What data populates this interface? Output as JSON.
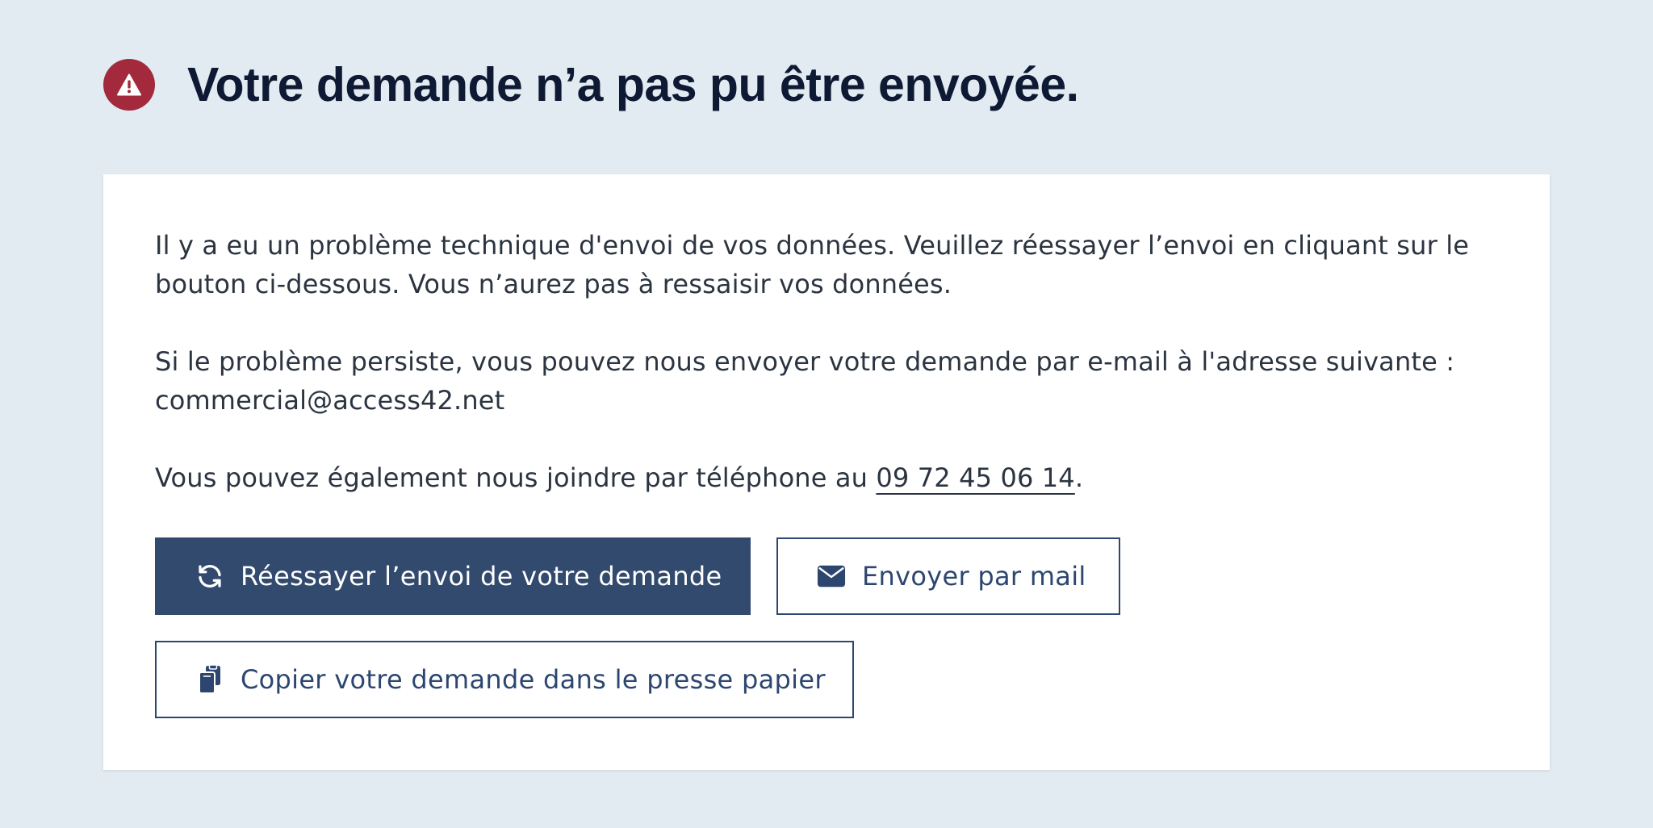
{
  "header": {
    "title": "Votre demande n’a pas pu être envoyée.",
    "icon": "warning-icon",
    "icon_color": "#a22a3c"
  },
  "message": {
    "paragraph1": "Il y a eu un problème technique d'envoi de vos données. Veuillez réessayer l’envoi en cliquant sur le bouton ci-dessous. Vous n’aurez pas à ressaisir vos données.",
    "paragraph2": "Si le problème persiste, vous pouvez nous envoyer votre demande par e-mail à l'adresse suivante : commercial@access42.net",
    "paragraph3_prefix": "Vous pouvez également nous joindre par téléphone au ",
    "phone": "09 72 45 06 14",
    "paragraph3_suffix": "."
  },
  "actions": {
    "retry_label": "Réessayer l’envoi de votre demande",
    "retry_icon": "refresh-icon",
    "mail_label": "Envoyer par mail",
    "mail_icon": "envelope-icon",
    "copy_label": "Copier votre demande dans le presse papier",
    "copy_icon": "clipboard-icon"
  },
  "colors": {
    "background": "#e2eaf2",
    "card": "#ffffff",
    "title": "#0e1a33",
    "primary_button": "#324a6d",
    "secondary_border": "#2d4670"
  }
}
